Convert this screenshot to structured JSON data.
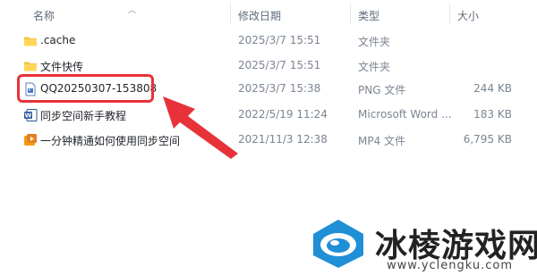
{
  "header": {
    "name": "名称",
    "date": "修改日期",
    "type": "类型",
    "size": "大小"
  },
  "files": [
    {
      "name": ".cache",
      "date": "2025/3/7 15:51",
      "type": "文件夹",
      "size": "",
      "icon": "folder-icon"
    },
    {
      "name": "文件快传",
      "date": "2025/3/7 15:51",
      "type": "文件夹",
      "size": "",
      "icon": "folder-icon"
    },
    {
      "name": "QQ20250307-153808",
      "date": "2025/3/7 15:38",
      "type": "PNG 文件",
      "size": "244 KB",
      "icon": "png-file-icon"
    },
    {
      "name": "同步空间新手教程",
      "date": "2022/5/19 11:24",
      "type": "Microsoft Word ...",
      "size": "183 KB",
      "icon": "word-doc-icon"
    },
    {
      "name": "一分钟精通如何使用同步空间",
      "date": "2021/11/3 12:38",
      "type": "MP4 文件",
      "size": "6,795 KB",
      "icon": "mp4-file-icon"
    }
  ],
  "watermark": {
    "title": "冰棱游戏网",
    "url": "www.yclengku.com"
  },
  "colors": {
    "highlight": "#e8323a",
    "folder": "#f5c243",
    "word": "#2b579a"
  }
}
